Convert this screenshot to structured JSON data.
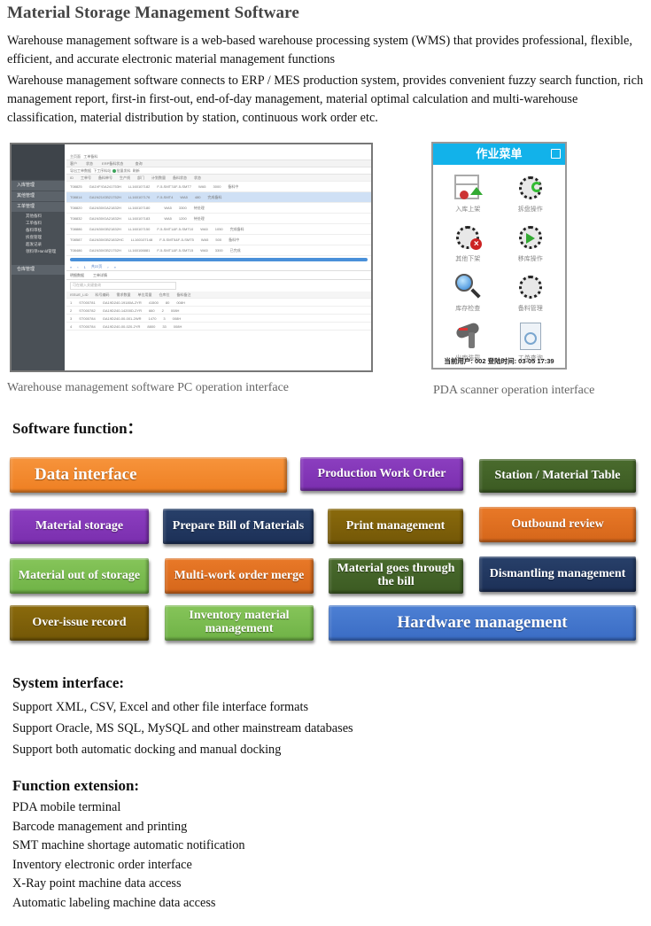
{
  "header": {
    "title": "Material Storage Management Software",
    "paragraphs": [
      "Warehouse management software is a web-based warehouse processing system (WMS) that provides professional, flexible, efficient, and accurate electronic material management functions",
      "Warehouse management software connects to ERP / MES production system, provides convenient fuzzy search function, rich management report, first-in first-out, end-of-day management, material optimal calculation and multi-warehouse classification, material distribution by station, continuous work order etc."
    ]
  },
  "pc_screenshot": {
    "caption": "Warehouse management software PC operation interface",
    "sidebar": {
      "groups": [
        "入库管理",
        "其他管理",
        "工单管理",
        "仓库管理"
      ],
      "subitems": [
        "其他备料",
        "工单备料",
        "备料审核",
        "拆盘管理",
        "超发记录",
        "领料单Hanld管理"
      ]
    },
    "breadcrumb": [
      "主页面",
      "工单备料"
    ],
    "filters": [
      "客户",
      "状态",
      "ERP备料状态",
      "查询"
    ],
    "toolbar": [
      "导出工单数据",
      "下工序料站",
      "批量发料",
      "刷新"
    ],
    "columns": [
      "ID",
      "工单号",
      "备料单号",
      "生产线",
      "部门",
      "计划数量",
      "计划日期",
      "客户",
      "备料状态",
      "状态",
      "备料单号",
      "工段号"
    ],
    "rows": [
      {
        "id": "T08825",
        "order": "GA1VF/GA241753H",
        "bom": "LL160107182",
        "line": "F-5-SMT7&F-5-SMT7",
        "dept": "WA5",
        "qty": "3000",
        "status": "备料中",
        "selected": false
      },
      {
        "id": "T08814",
        "order": "GA1N21/GB21752H",
        "bom": "LL160107176",
        "line": "F-5-SMT4",
        "dept": "WA5",
        "qty": "480",
        "status": "完成备料",
        "selected": true
      },
      {
        "id": "T08820",
        "order": "GA1N30/GA21832H",
        "bom": "LL160107180",
        "line": "",
        "dept": "WA5",
        "qty": "3300",
        "status": "待处理",
        "selected": false
      },
      {
        "id": "T08832",
        "order": "GA1N30/GA21832H",
        "bom": "LL160107183",
        "line": "",
        "dept": "WA5",
        "qty": "1200",
        "status": "待处理",
        "selected": false
      },
      {
        "id": "T08886",
        "order": "GA1N30/GB21832H",
        "bom": "LL160107150",
        "line": "F-5-SMT1&F-5-SMT10",
        "dept": "WA5",
        "qty": "1050",
        "status": "完成备料",
        "selected": false
      },
      {
        "id": "T08587",
        "order": "GA1N30/GB21832HC",
        "bom": "LL160107148",
        "line": "F-5-SMT5&F-5-SMT5",
        "dept": "WA5",
        "qty": "500",
        "status": "备料中",
        "selected": false
      },
      {
        "id": "T08486",
        "order": "GA1N30/GB21752H",
        "bom": "LL160108881",
        "line": "F-5-SMT1&F-5-SMT15",
        "dept": "WA5",
        "qty": "3300",
        "status": "已完成",
        "selected": false
      }
    ],
    "pager": {
      "page": "1",
      "text": "共22页"
    },
    "sub_tabs": [
      "明细数据",
      "工单详情"
    ],
    "sub_search_placeholder": "可在输入关键查询",
    "sub_columns": [
      "ISSUE_LID",
      "料号编码",
      "需求数量",
      "单位用量",
      "仓库位",
      "备料备注"
    ],
    "sub_rows": [
      {
        "n": "1",
        "lid": "ST000781",
        "code": "GA19D240-19180A-2YR",
        "need": "41500",
        "unit": "80",
        "loc": "008H"
      },
      {
        "n": "2",
        "lid": "ST000782",
        "code": "GA19D240-14200D-2YR",
        "need": "660",
        "unit": "2",
        "loc": "008H"
      },
      {
        "n": "3",
        "lid": "ST000784",
        "code": "GA19D240-00-001-2WR",
        "need": "1470",
        "unit": "3",
        "loc": "008H"
      },
      {
        "n": "4",
        "lid": "ST000784",
        "code": "GA19D240-00-020-2YR",
        "need": "8800",
        "unit": "33",
        "loc": "008H"
      }
    ]
  },
  "pda_screenshot": {
    "caption": "PDA scanner operation interface",
    "title": "作业菜单",
    "menu": [
      {
        "label": "入库上架",
        "icon": "shelf-icon"
      },
      {
        "label": "拆盘操作",
        "icon": "reel-split-icon"
      },
      {
        "label": "其他下架",
        "icon": "reel-remove-icon"
      },
      {
        "label": "移库操作",
        "icon": "reel-move-icon"
      },
      {
        "label": "库存检查",
        "icon": "magnifier-icon"
      },
      {
        "label": "备料管理",
        "icon": "reel-icon"
      },
      {
        "label": "出库装载",
        "icon": "scanner-icon"
      },
      {
        "label": "工单查询",
        "icon": "document-icon"
      }
    ],
    "footer": "当前用户: 002   登陆时间: 03-05 17:39"
  },
  "software_function": {
    "heading": "Software function：",
    "tiles": [
      {
        "label": "Data interface",
        "color": "#f28a2f"
      },
      {
        "label": "Production Work Order",
        "color": "#8436b7"
      },
      {
        "label": "Station / Material Table",
        "color": "#436328"
      },
      {
        "label": "Material storage",
        "color": "#8436b7"
      },
      {
        "label": "Prepare Bill of Materials",
        "color": "#223862"
      },
      {
        "label": "Print management",
        "color": "#7f610a"
      },
      {
        "label": "Outbound review",
        "color": "#df6f21"
      },
      {
        "label": "Material out of storage",
        "color": "#7abc50"
      },
      {
        "label": "Multi-work order merge",
        "color": "#df6f21"
      },
      {
        "label": "Material goes through the bill",
        "color": "#436328"
      },
      {
        "label": "Dismantling management",
        "color": "#223862"
      },
      {
        "label": "Over-issue record",
        "color": "#7f610a"
      },
      {
        "label": "Inventory material management",
        "color": "#7abc50"
      },
      {
        "label": "Hardware management",
        "color": "#4476cc"
      }
    ]
  },
  "system_interface": {
    "heading": "System interface:",
    "items": [
      "Support XML, CSV, Excel and other file interface formats",
      "Support Oracle, MS SQL, MySQL and other mainstream databases",
      "Support both automatic docking and manual docking"
    ]
  },
  "function_extension": {
    "heading": "Function extension:",
    "items": [
      "PDA mobile terminal",
      "Barcode management and printing",
      "SMT machine shortage automatic notification",
      "Inventory electronic order interface",
      "X-Ray point machine data access",
      "Automatic labeling machine data access"
    ]
  }
}
